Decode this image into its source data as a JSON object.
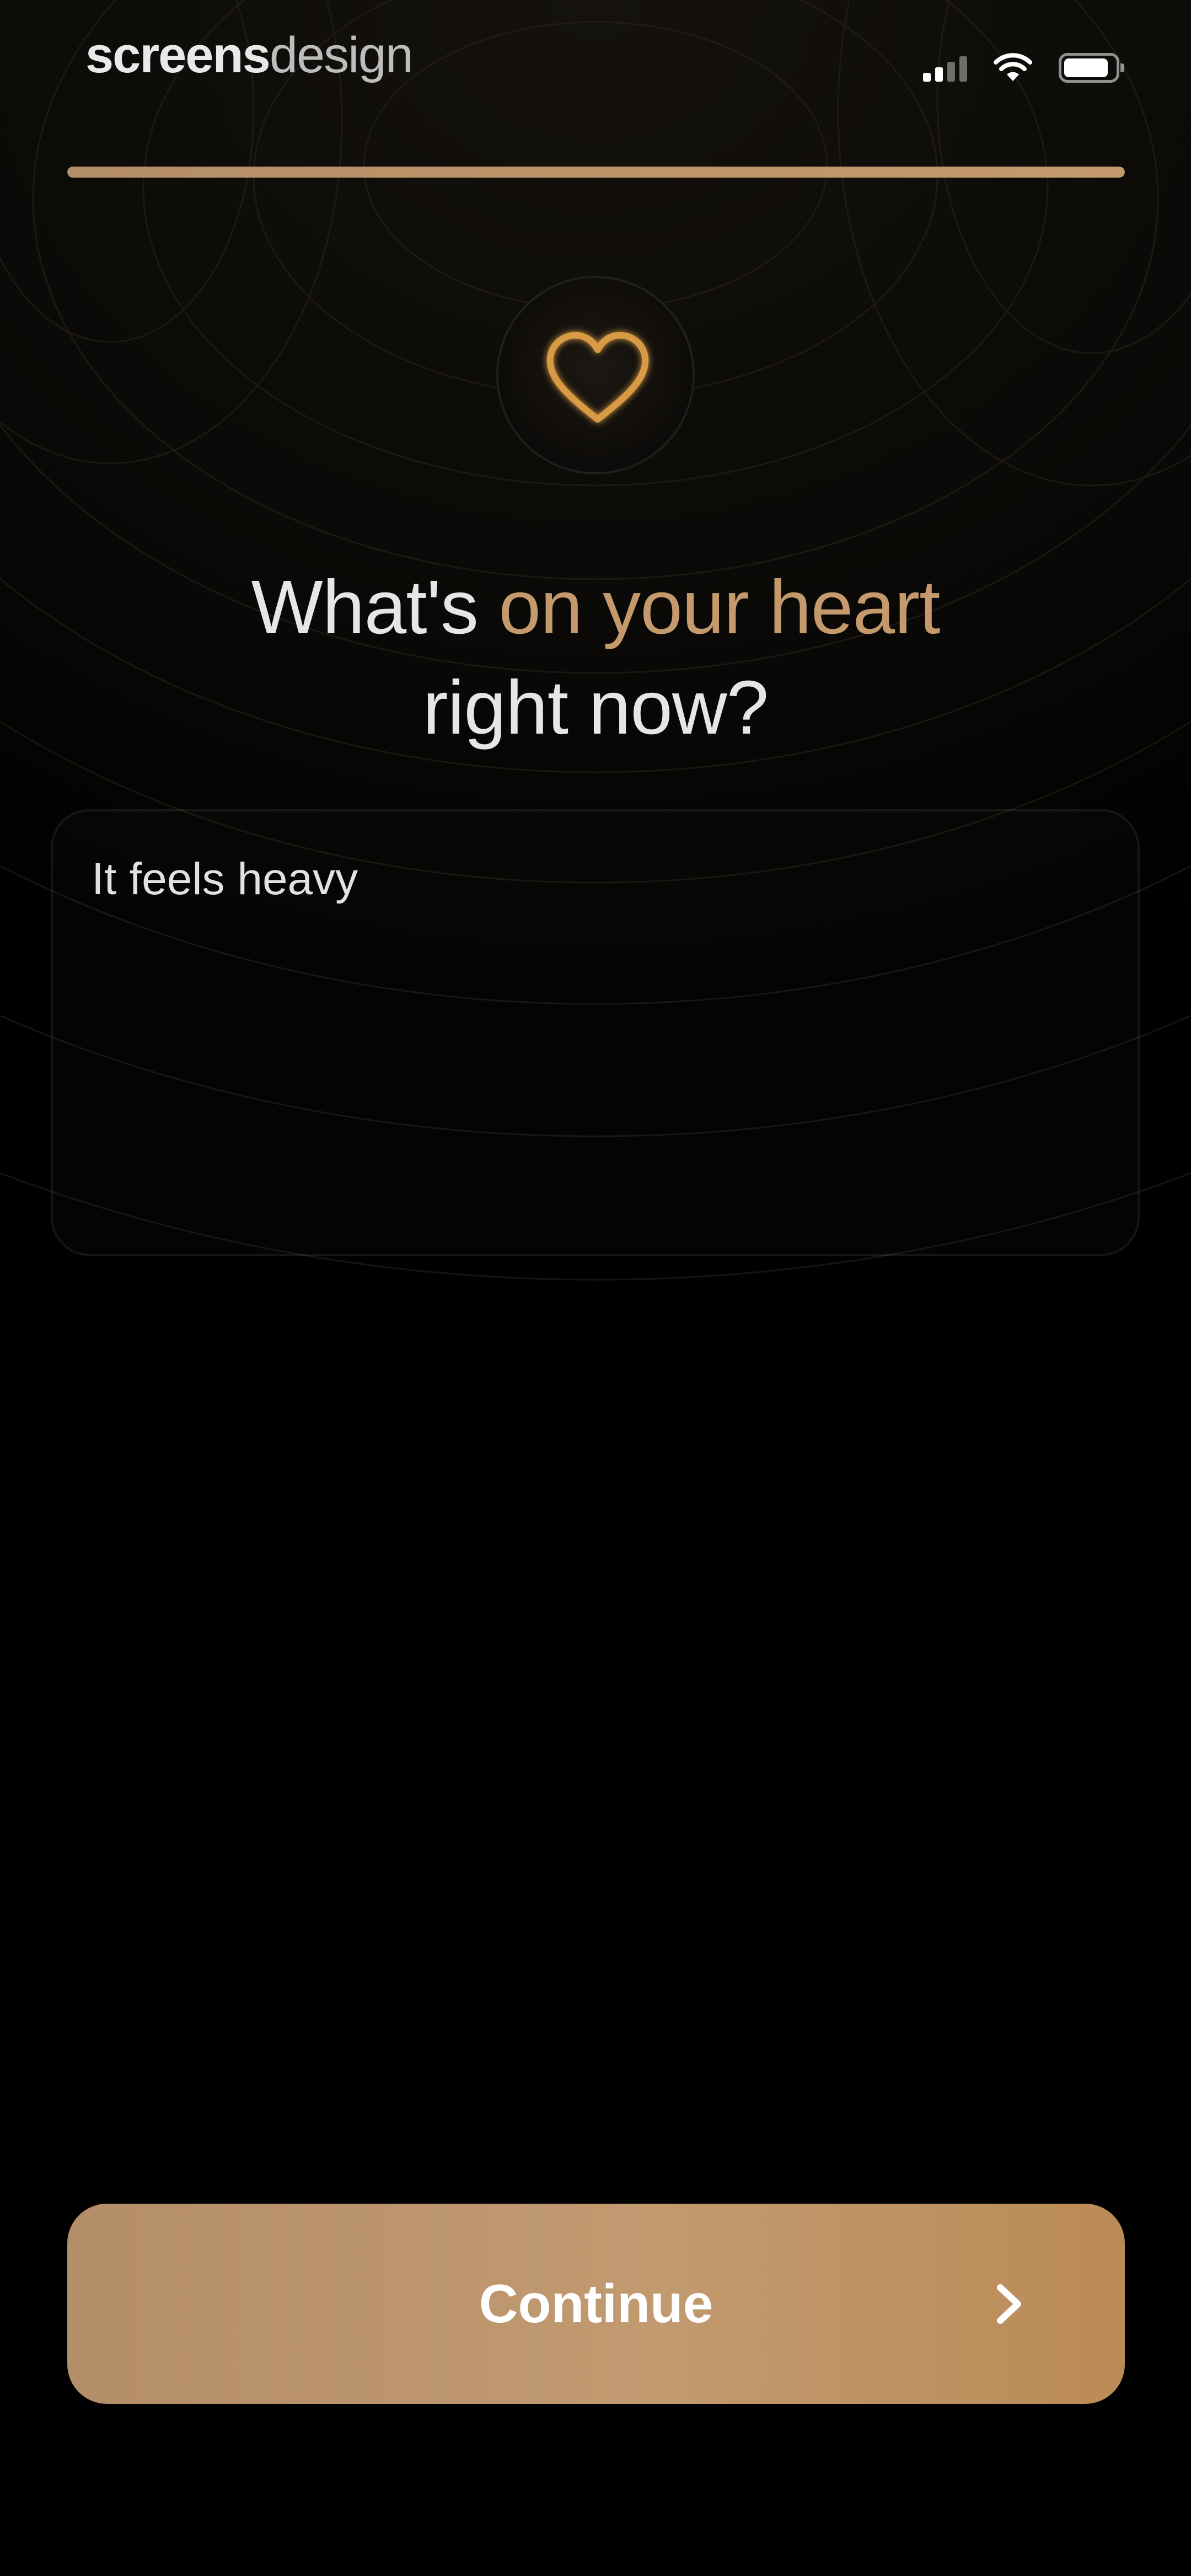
{
  "status_bar": {
    "brand_bold": "screens",
    "brand_light": "design",
    "signal_icon": "cellular-signal-icon",
    "wifi_icon": "wifi-icon",
    "battery_icon": "battery-icon"
  },
  "progress": {
    "fraction": 1.0
  },
  "hero": {
    "icon": "heart-icon"
  },
  "title": {
    "part1": "What's ",
    "accent": "on your heart",
    "part2": "right now?"
  },
  "entry": {
    "value": "It feels heavy"
  },
  "continue_button": {
    "label": "Continue",
    "icon": "chevron-right-icon"
  },
  "colors": {
    "accent": "#c49a6c",
    "background": "#000000",
    "button": "#bb9266"
  }
}
